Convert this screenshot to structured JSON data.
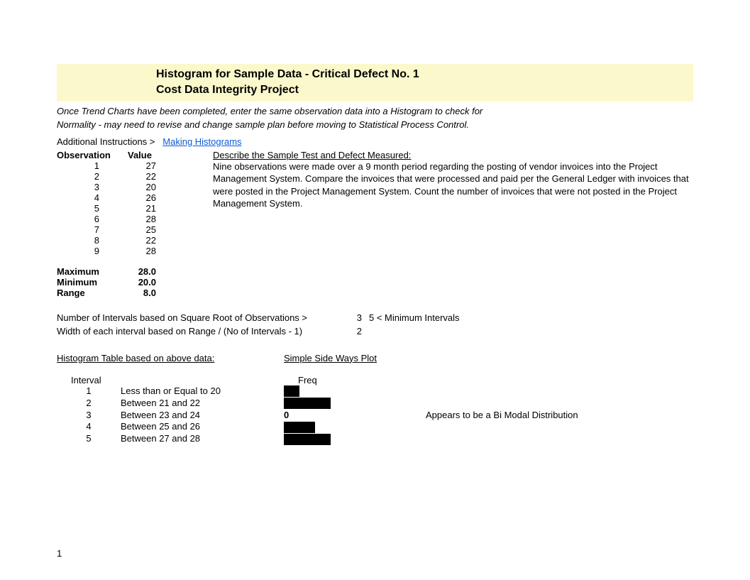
{
  "title": {
    "line1": "Histogram for Sample Data - Critical Defect No. 1",
    "line2": "Cost Data Integrity Project"
  },
  "intro": {
    "line1": "Once Trend Charts have been completed, enter the same observation data into a Histogram to check for",
    "line2": "Normality - may need to revise and change sample plan before moving to Statistical Process Control."
  },
  "instructions_label": "Additional Instructions >",
  "instructions_link": "Making Histograms",
  "obs": {
    "header_obs": "Observation",
    "header_val": "Value",
    "rows": [
      {
        "n": "1",
        "v": "27"
      },
      {
        "n": "2",
        "v": "22"
      },
      {
        "n": "3",
        "v": "20"
      },
      {
        "n": "4",
        "v": "26"
      },
      {
        "n": "5",
        "v": "21"
      },
      {
        "n": "6",
        "v": "28"
      },
      {
        "n": "7",
        "v": "25"
      },
      {
        "n": "8",
        "v": "22"
      },
      {
        "n": "9",
        "v": "28"
      }
    ]
  },
  "describe": {
    "header": "Describe the Sample Test and Defect Measured:",
    "body": "Nine observations were made over a 9 month period regarding the posting of vendor invoices into the Project Management System. Compare the invoices that were processed and paid per the General Ledger with invoices that were posted in the Project Management System. Count the number of invoices that were not posted in the Project Management System."
  },
  "stats": {
    "max_label": "Maximum",
    "max_val": "28.0",
    "min_label": "Minimum",
    "min_val": "20.0",
    "range_label": "Range",
    "range_val": "8.0"
  },
  "calc": {
    "line1_text": "Number of Intervals based on Square Root of Observations >",
    "line1_num": "3",
    "line1_rest": "5   < Minimum Intervals",
    "line2_text": "Width of each interval based on Range / (No of Intervals - 1)",
    "line2_num": "2"
  },
  "hist": {
    "left_header": "Histogram Table based on above data:",
    "right_header": "Simple Side Ways Plot",
    "interval_label": "Interval",
    "freq_label": "Freq",
    "rows": [
      {
        "i": "1",
        "desc": "Less than or Equal to 20",
        "f": "1"
      },
      {
        "i": "2",
        "desc": "Between 21 and 22",
        "f": "3"
      },
      {
        "i": "3",
        "desc": "Between 23 and 24",
        "f": "0"
      },
      {
        "i": "4",
        "desc": "Between 25 and 26",
        "f": "2"
      },
      {
        "i": "5",
        "desc": "Between 27 and 28",
        "f": "3"
      }
    ],
    "note": "Appears to be a Bi Modal Distribution"
  },
  "page_number": "1",
  "chart_data": {
    "type": "bar",
    "orientation": "horizontal",
    "title": "Simple Side Ways Plot",
    "categories": [
      "Less than or Equal to 20",
      "Between 21 and 22",
      "Between 23 and 24",
      "Between 25 and 26",
      "Between 27 and 28"
    ],
    "values": [
      1,
      3,
      0,
      2,
      3
    ],
    "xlabel": "Freq",
    "ylabel": "Interval",
    "annotation": "Appears to be a Bi Modal Distribution"
  }
}
